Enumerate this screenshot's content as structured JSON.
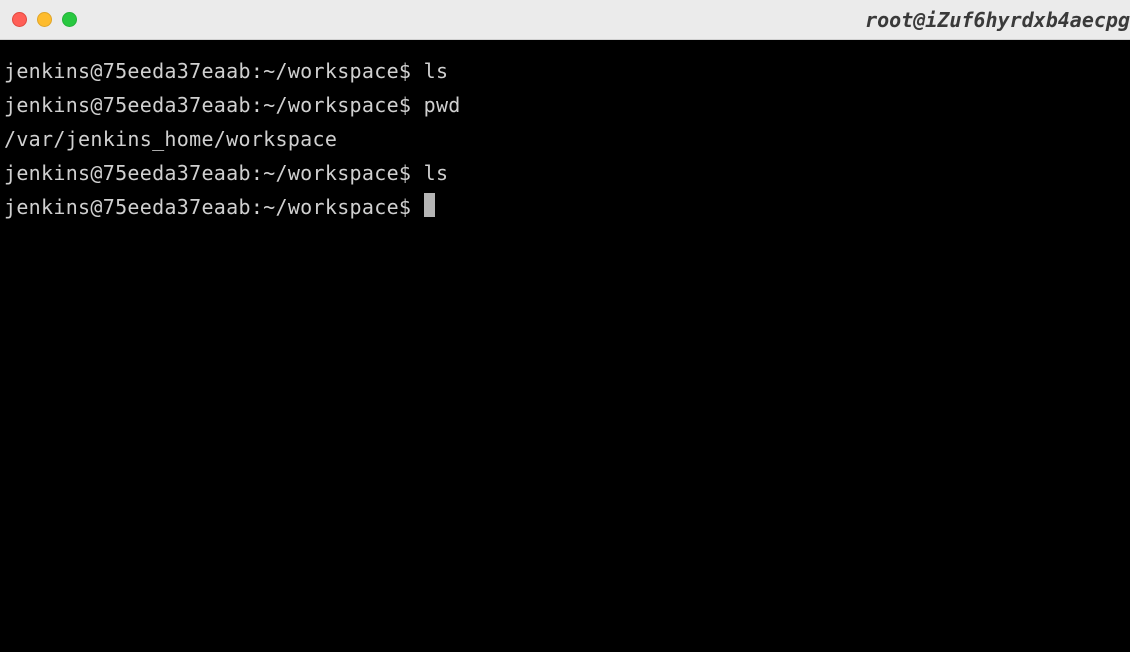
{
  "window": {
    "title": "root@iZuf6hyrdxb4aecpg"
  },
  "terminal": {
    "lines": [
      {
        "prompt": "jenkins@75eeda37eaab:~/workspace$ ",
        "command": "ls"
      },
      {
        "prompt": "jenkins@75eeda37eaab:~/workspace$ ",
        "command": "pwd"
      },
      {
        "output": "/var/jenkins_home/workspace"
      },
      {
        "prompt": "jenkins@75eeda37eaab:~/workspace$ ",
        "command": "ls"
      },
      {
        "prompt": "jenkins@75eeda37eaab:~/workspace$ ",
        "cursor": true
      }
    ]
  }
}
